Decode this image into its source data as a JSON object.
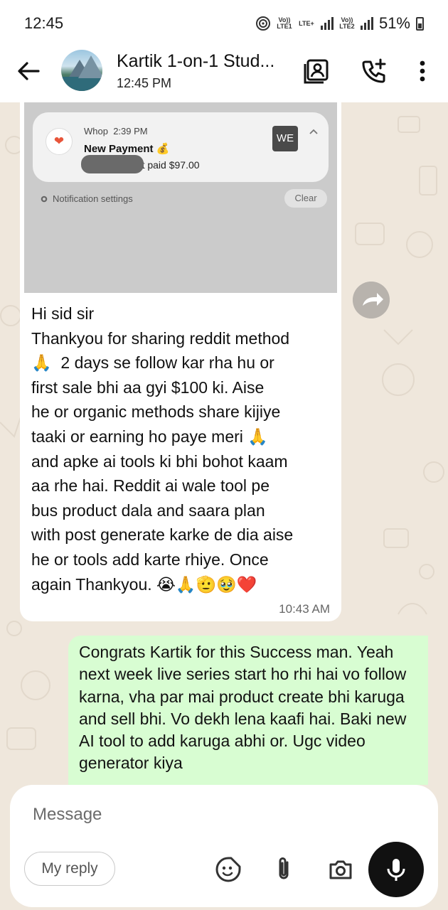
{
  "status_bar": {
    "time": "12:45",
    "lte1": "Vo)) LTE1",
    "lte_plus": "LTE+",
    "lte2": "Vo)) LTE2",
    "battery": "51%"
  },
  "header": {
    "title": "Kartik 1-on-1 Stud...",
    "subtitle": "12:45 PM"
  },
  "shared_screenshot": {
    "app": "Whop",
    "time": "2:39 PM",
    "title": "New Payment 💰",
    "body": "e just paid $97.00",
    "badge": "WE",
    "settings_label": "Notification settings",
    "clear_label": "Clear"
  },
  "incoming_message": {
    "text": "Hi sid sir\nThankyou for sharing reddit method\n🙏  2 days se follow kar rha hu or\nfirst sale bhi aa gyi $100 ki. Aise\nhe or organic methods share kijiye\ntaaki or earning ho paye meri 🙏\nand apke ai tools ki bhi bohot kaam\naa rhe hai. Reddit ai wale tool pe\nbus product dala and saara plan\nwith post generate karke de dia aise\nhe or tools add karte rhiye. Once\nagain Thankyou. 😭🙏🫡🥹❤️",
    "time": "10:43 AM"
  },
  "outgoing_message": {
    "text": "Congrats Kartik for this Success man. Yeah next week live series start ho rhi hai vo follow karna, vha par mai product create bhi karuga and sell bhi. Vo dekh lena kaafi hai. Baki new AI tool to add karuga abhi or. Ugc video generator kiya"
  },
  "composer": {
    "placeholder": "Message",
    "my_reply": "My reply"
  },
  "colors": {
    "outgoing_bubble": "#d8fdd2",
    "incoming_bubble": "#ffffff",
    "wallpaper": "#efe7dc"
  }
}
